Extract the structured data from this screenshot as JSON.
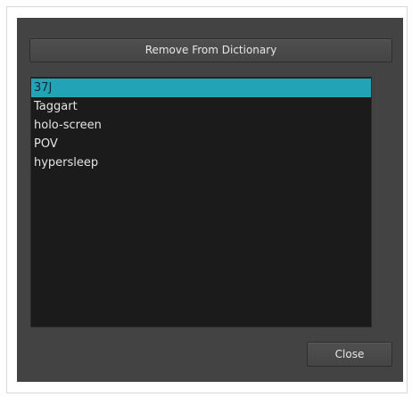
{
  "dialog": {
    "remove_label": "Remove From Dictionary",
    "close_label": "Close"
  },
  "dictionary": {
    "items": [
      {
        "label": "37J"
      },
      {
        "label": "Taggart"
      },
      {
        "label": "holo-screen"
      },
      {
        "label": "POV"
      },
      {
        "label": "hypersleep"
      }
    ],
    "selected_index": 0
  },
  "colors": {
    "dialog_background": "#434343",
    "list_background": "#1b1b1b",
    "selection": "#22a3b6"
  }
}
